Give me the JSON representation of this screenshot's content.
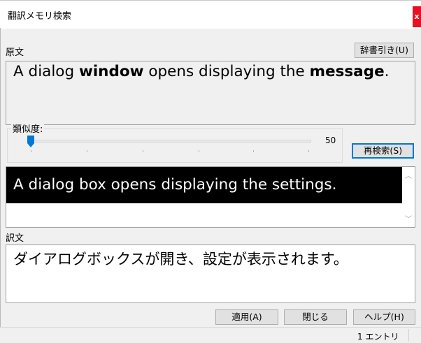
{
  "window": {
    "title": "翻訳メモリ検索",
    "close_label": "x"
  },
  "source": {
    "label": "原文",
    "dict_button": "辞書引き(U)",
    "text_parts": [
      {
        "text": "A dialog ",
        "bold": false
      },
      {
        "text": "window",
        "bold": true
      },
      {
        "text": " opens displaying the ",
        "bold": false
      },
      {
        "text": "message",
        "bold": true
      },
      {
        "text": ".",
        "bold": false
      }
    ]
  },
  "similarity": {
    "label": "類似度:",
    "value": "50",
    "value_fraction": 0.0,
    "research_button": "再検索(S)"
  },
  "match": {
    "text": "A dialog box opens displaying the settings."
  },
  "translation": {
    "label": "訳文",
    "text": "ダイアログボックスが開き、設定が表示されます。"
  },
  "buttons": {
    "apply": "適用(A)",
    "close": "閉じる",
    "help": "ヘルプ(H)"
  },
  "status": {
    "entries": "1 エントリ"
  },
  "colors": {
    "close_button": "#e81123",
    "slider_thumb": "#0078d7",
    "selection": "#000000"
  }
}
